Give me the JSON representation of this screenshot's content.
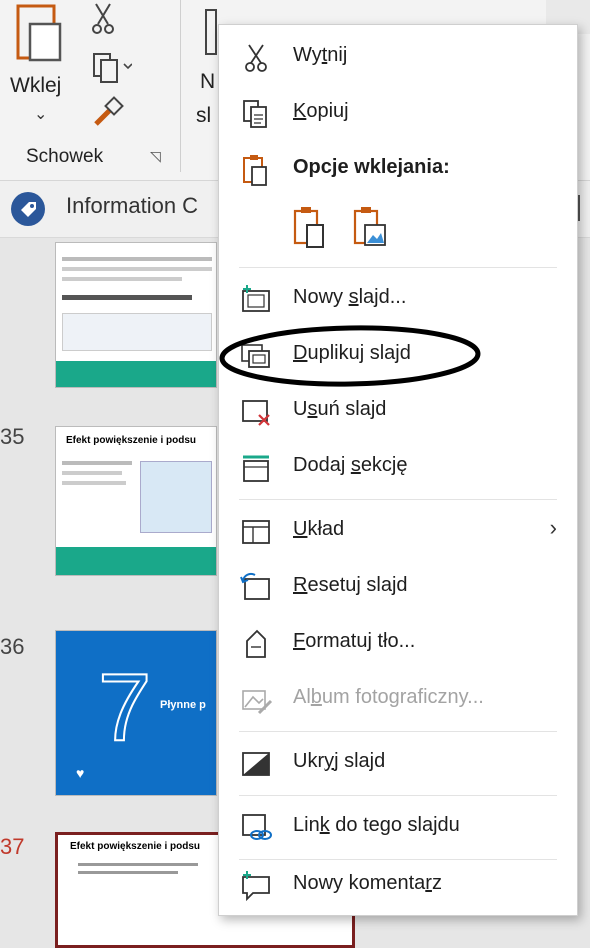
{
  "ribbon": {
    "paste_label": "Wklej",
    "clipboard_group": "Schowek",
    "partial_label_m": "N",
    "partial_label_sl": "sl"
  },
  "infobar": {
    "text": "Information C"
  },
  "slides": [
    {
      "number": "",
      "title": ""
    },
    {
      "number": "35",
      "title": "Efekt powiększenie i podsu"
    },
    {
      "number": "36",
      "title": "Płynne p"
    },
    {
      "number": "37",
      "title": "Efekt powiększenie i podsu"
    }
  ],
  "menu": {
    "cut": {
      "pre": "Wy",
      "ul": "t",
      "post": "nij"
    },
    "copy": {
      "pre": "",
      "ul": "K",
      "post": "opiuj"
    },
    "paste_options": "Opcje wklejania:",
    "new_slide": {
      "pre": "Nowy ",
      "ul": "s",
      "post": "lajd..."
    },
    "duplicate_slide": {
      "pre": "",
      "ul": "D",
      "post": "uplikuj slajd"
    },
    "delete_slide": {
      "pre": "U",
      "ul": "s",
      "post": "uń slajd"
    },
    "add_section": {
      "pre": "Dodaj ",
      "ul": "s",
      "post": "ekcję"
    },
    "layout": {
      "pre": "",
      "ul": "U",
      "post": "kład"
    },
    "reset_slide": {
      "pre": "",
      "ul": "R",
      "post": "esetuj slajd"
    },
    "format_background": {
      "pre": "",
      "ul": "F",
      "post": "ormatuj tło..."
    },
    "photo_album": {
      "pre": "Al",
      "ul": "b",
      "post": "um fotograficzny..."
    },
    "hide_slide": {
      "pre": "Ukr",
      "ul": "y",
      "post": "j slajd"
    },
    "link_slide": {
      "pre": "Lin",
      "ul": "k",
      "post": " do tego slajdu"
    },
    "new_comment": {
      "pre": "Nowy komenta",
      "ul": "r",
      "post": "z"
    }
  },
  "colors": {
    "accent": "#c55a11",
    "teal": "#1aa88a",
    "blue": "#0f6fc6",
    "annotation": "#000000"
  }
}
